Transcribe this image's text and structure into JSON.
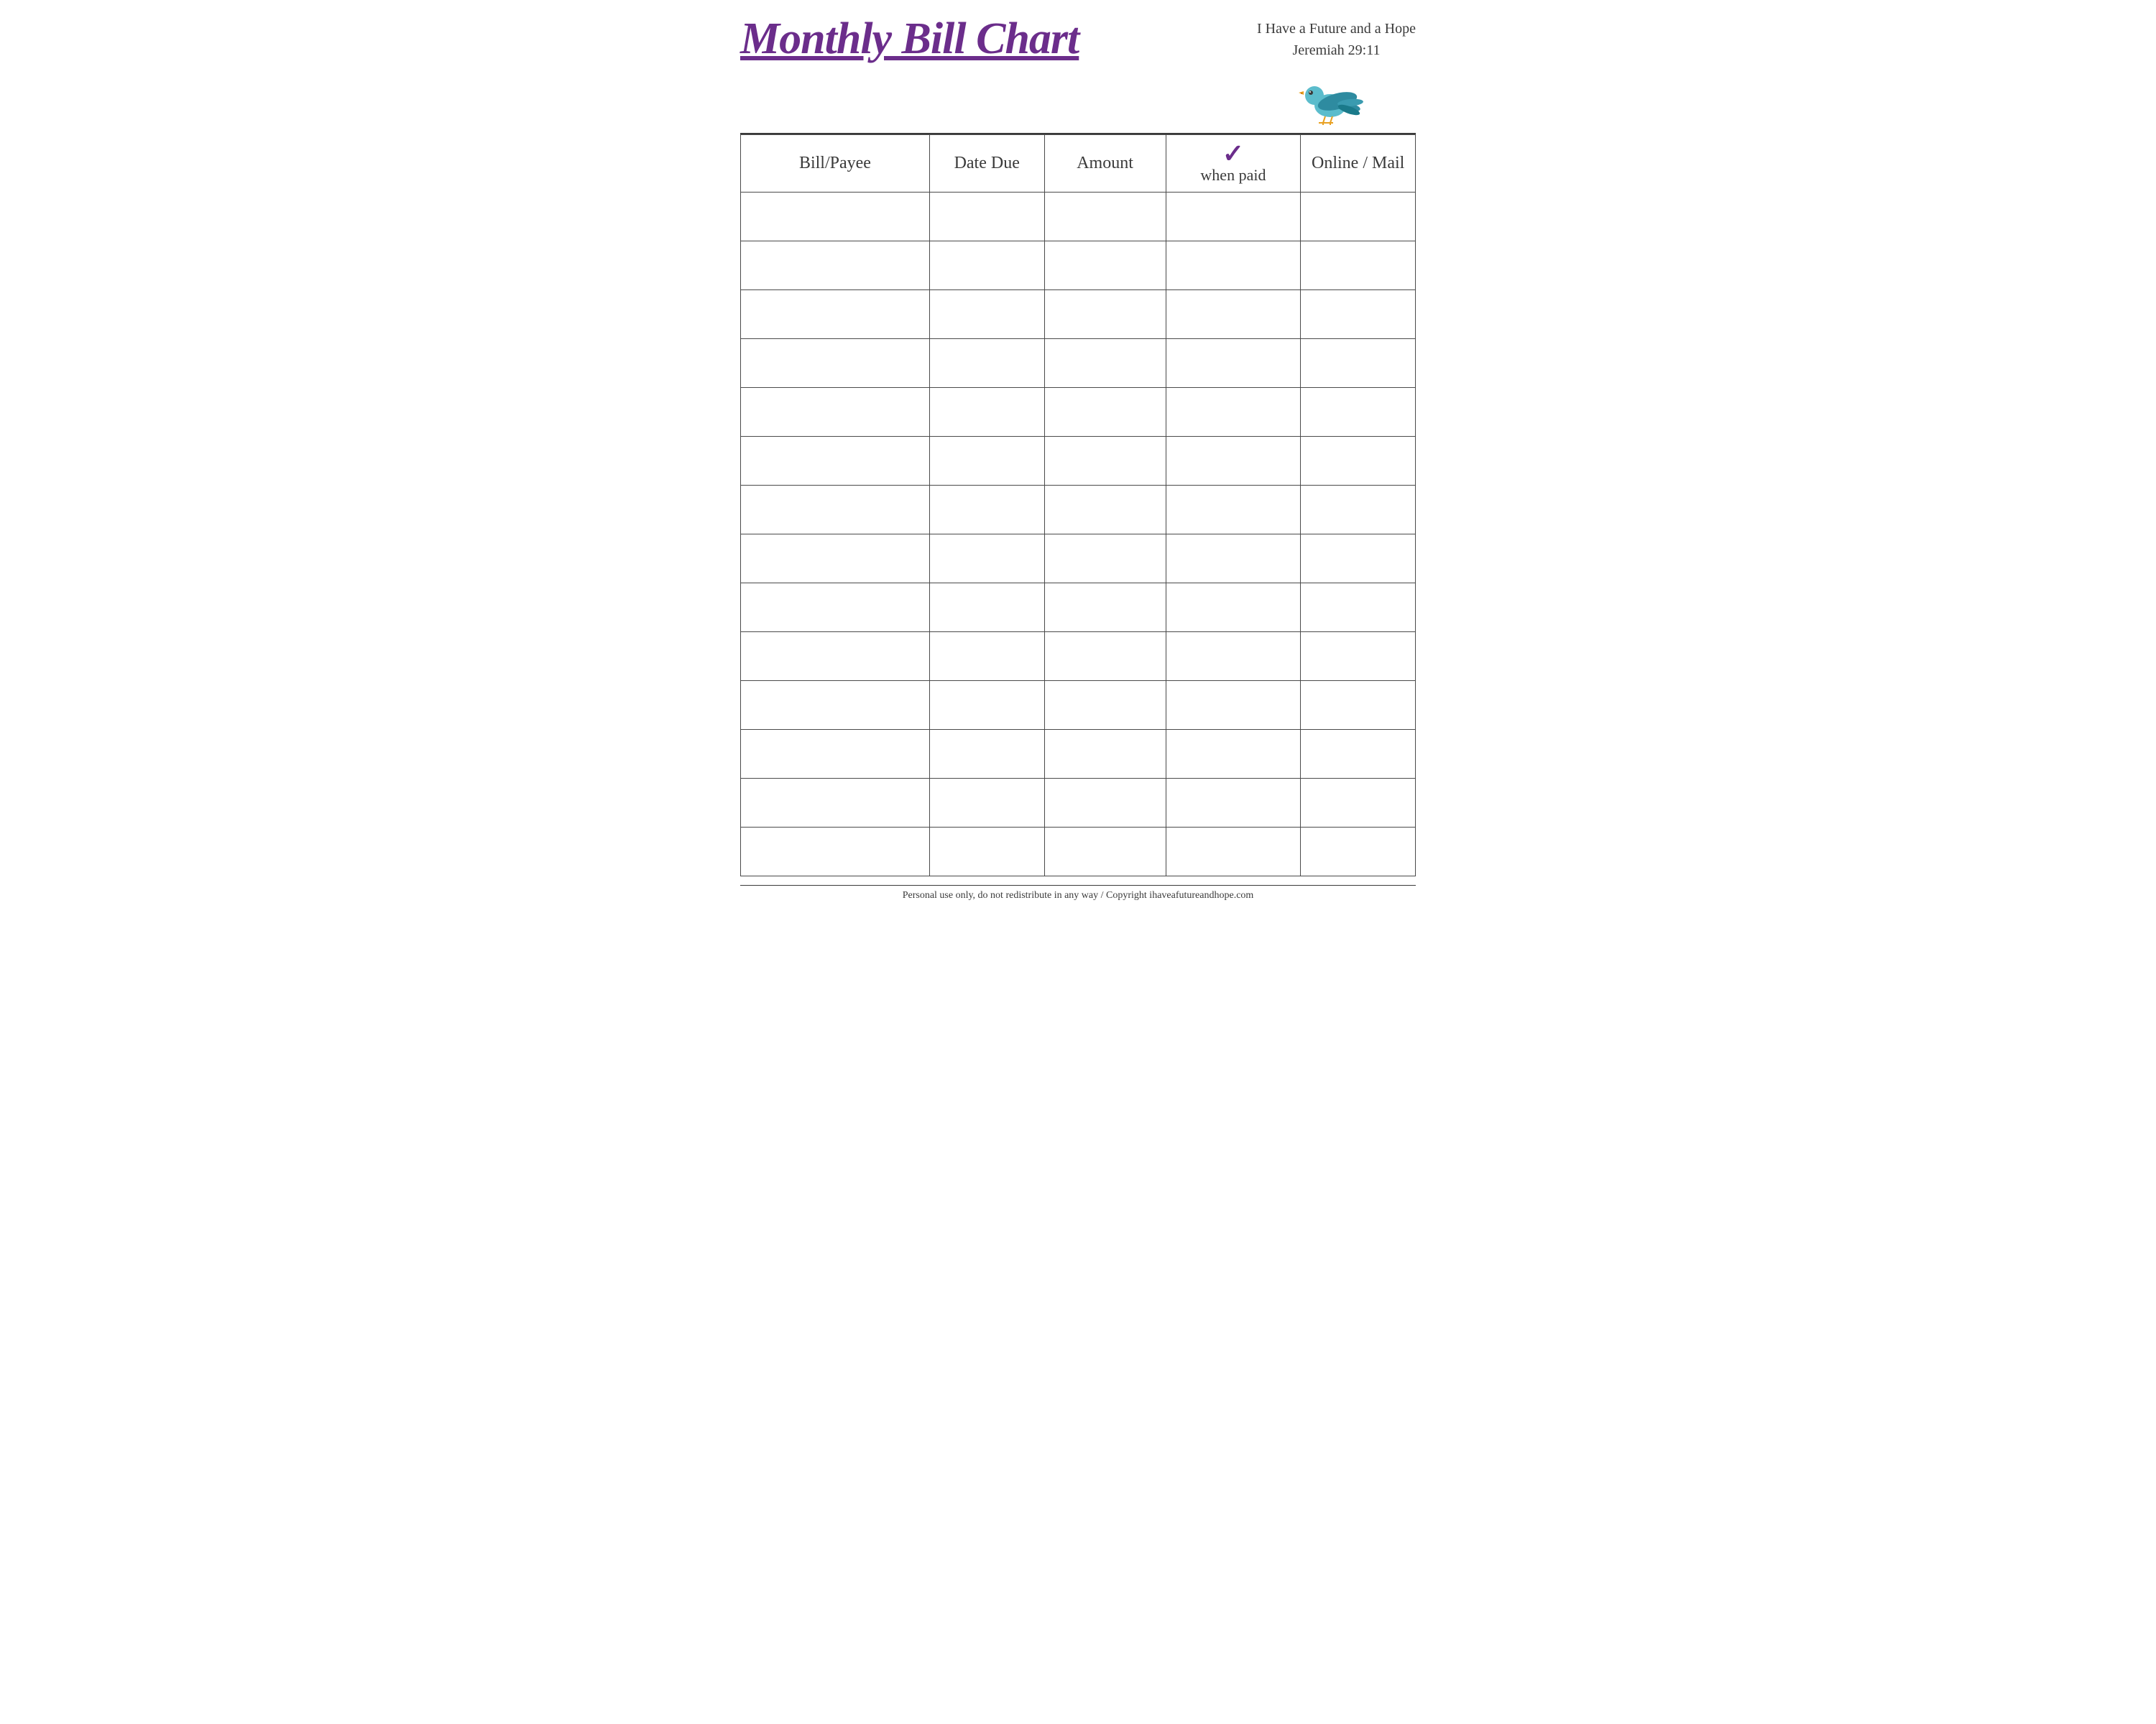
{
  "header": {
    "title": "Monthly Bill Chart",
    "scripture_line1": "I Have a Future and a Hope",
    "scripture_line2": "Jeremiah 29:11"
  },
  "table": {
    "columns": [
      {
        "id": "payee",
        "label": "Bill/Payee"
      },
      {
        "id": "date",
        "label": "Date Due"
      },
      {
        "id": "amount",
        "label": "Amount"
      },
      {
        "id": "check",
        "label": "Check when paid",
        "check_symbol": "✓"
      },
      {
        "id": "online",
        "label": "Online / Mail"
      }
    ],
    "row_count": 14
  },
  "footer": {
    "text": "Personal use only, do not redistribute in any way / Copyright ihaveafutureandhope.com"
  }
}
